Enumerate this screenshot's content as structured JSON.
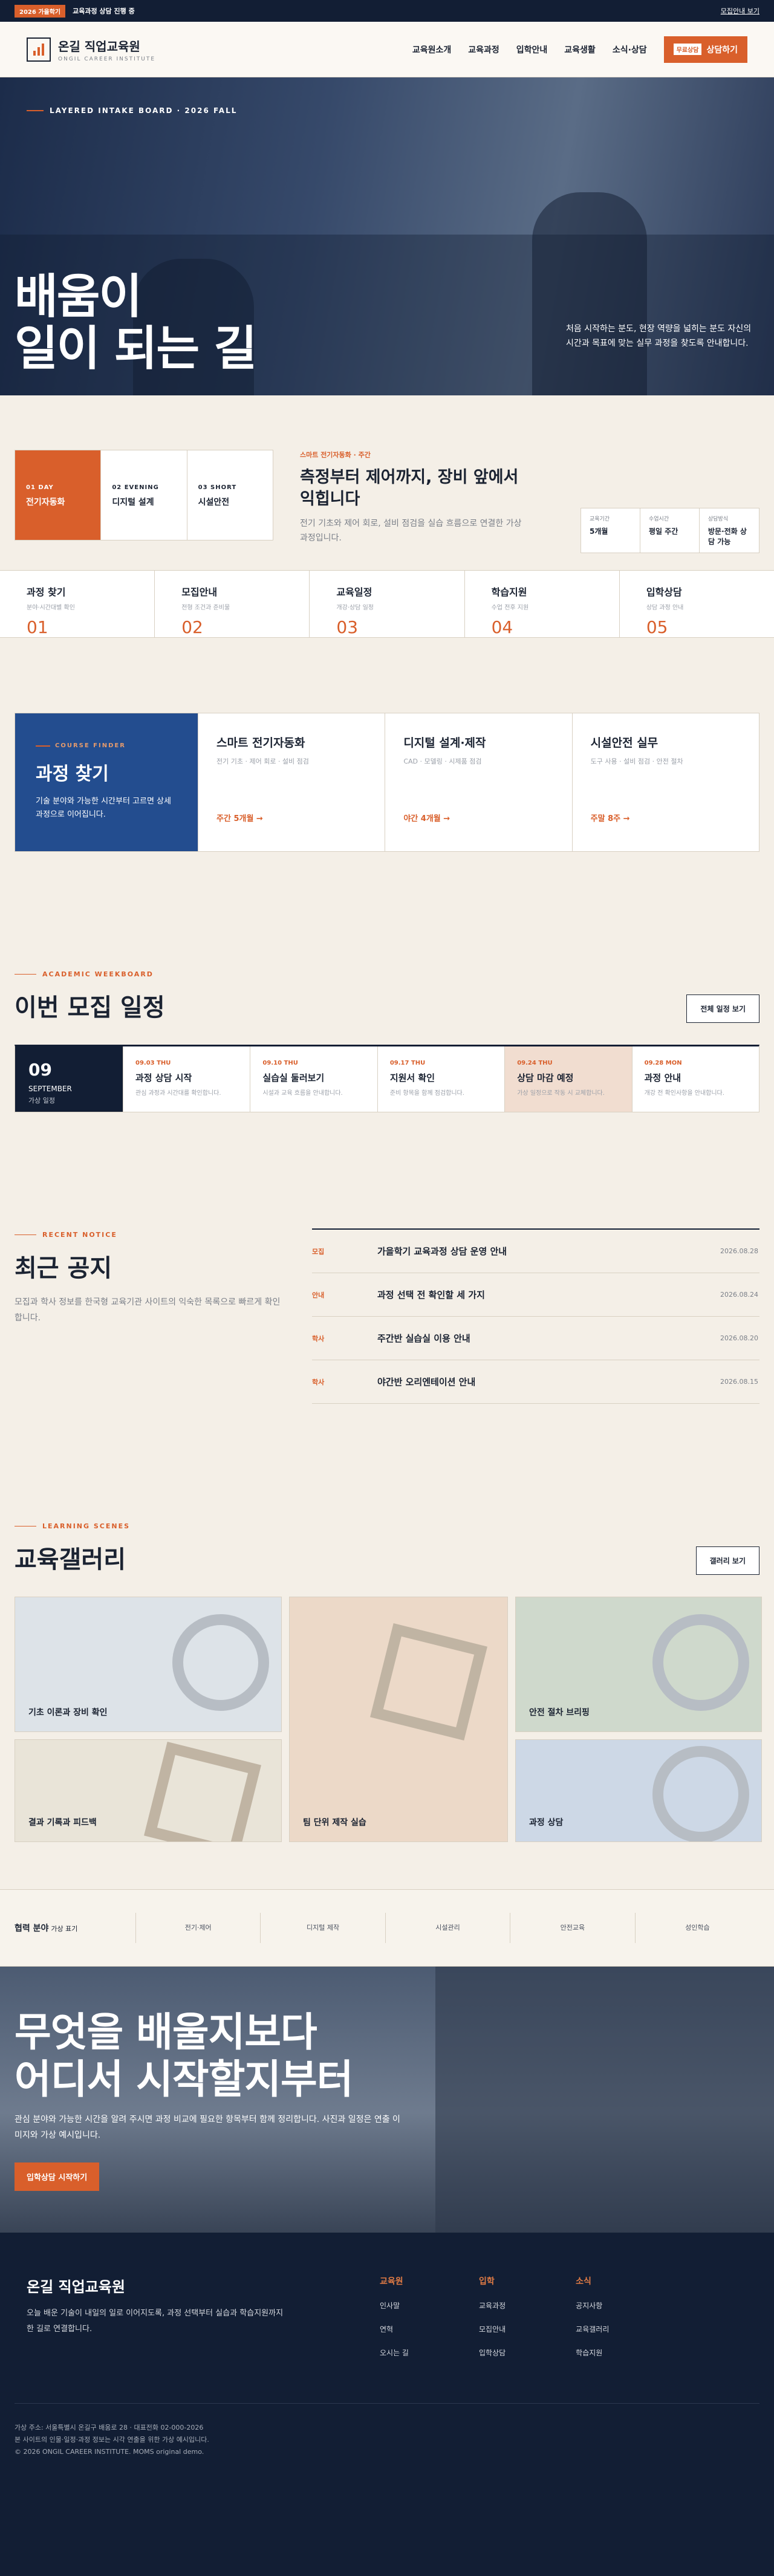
{
  "topbar": {
    "badge": "2026 가을학기",
    "notice": "교육과정 상담 진행 중",
    "right_link": "모집안내 보기"
  },
  "header": {
    "logo_ko": "온길 직업교육원",
    "logo_en": "ONGIL CAREER INSTITUTE",
    "nav": [
      "교육원소개",
      "교육과정",
      "입학안내",
      "교육생활",
      "소식·상담"
    ],
    "cta_tag": "무료상담",
    "cta_label": "상담하기"
  },
  "hero": {
    "kicker": "LAYERED INTAKE BOARD · 2026 FALL",
    "title_line1": "배움이",
    "title_line2": "일이 되는 길",
    "desc": "처음 시작하는 분도, 현장 역량을 넓히는 분도 자신의 시간과 목표에 맞는 실무 과정을 찾도록 안내합니다."
  },
  "track": {
    "tabs": [
      {
        "k": "01 DAY",
        "v": "전기자동화"
      },
      {
        "k": "02 EVENING",
        "v": "디지털 설계"
      },
      {
        "k": "03 SHORT",
        "v": "시설안전"
      }
    ],
    "kicker": "스마트 전기자동화 · 주간",
    "title": "측정부터 제어까지, 장비 앞에서 익힙니다",
    "desc": "전기 기초와 제어 회로, 설비 점검을 실습 흐름으로 연결한 가상 과정입니다.",
    "stats": [
      {
        "l": "교육기간",
        "v": "5개월"
      },
      {
        "l": "수업시간",
        "v": "평일 주간"
      },
      {
        "l": "상담방식",
        "v": "방문·전화 상담 가능"
      }
    ]
  },
  "quick": [
    {
      "t": "과정 찾기",
      "s": "분야·시간대별 확인",
      "n": "01"
    },
    {
      "t": "모집안내",
      "s": "전형 조건과 준비물",
      "n": "02"
    },
    {
      "t": "교육일정",
      "s": "개강·상담 일정",
      "n": "03"
    },
    {
      "t": "학습지원",
      "s": "수업 전후 지원",
      "n": "04"
    },
    {
      "t": "입학상담",
      "s": "상담 과정 안내",
      "n": "05"
    }
  ],
  "finder": {
    "kicker": "COURSE FINDER",
    "title": "과정 찾기",
    "desc": "기술 분야와 가능한 시간부터 고르면 상세 과정으로 이어집니다.",
    "cards": [
      {
        "t": "스마트 전기자동화",
        "s": "전기 기초 · 제어 회로 · 설비 점검",
        "m": "주간 5개월 →"
      },
      {
        "t": "디지털 설계·제작",
        "s": "CAD · 모델링 · 시제품 점검",
        "m": "야간 4개월 →"
      },
      {
        "t": "시설안전 실무",
        "s": "도구 사용 · 설비 점검 · 안전 절차",
        "m": "주말 8주 →"
      }
    ]
  },
  "schedule": {
    "kicker": "ACADEMIC WEEKBOARD",
    "title": "이번 모집 일정",
    "button": "전체 일정 보기",
    "month": {
      "d": "09",
      "m": "SEPTEMBER",
      "g": "가상 일정"
    },
    "events": [
      {
        "dt": "09.03 THU",
        "t": "과정 상담 시작",
        "s": "관심 과정과 시간대를 확인합니다."
      },
      {
        "dt": "09.10 THU",
        "t": "실습실 둘러보기",
        "s": "시설과 교육 흐름을 안내합니다."
      },
      {
        "dt": "09.17 THU",
        "t": "지원서 확인",
        "s": "준비 항목을 함께 점검합니다."
      },
      {
        "dt": "09.24 THU",
        "t": "상담 마감 예정",
        "s": "가상 일정으로 작동 시 교체합니다."
      },
      {
        "dt": "09.28 MON",
        "t": "과정 안내",
        "s": "개강 전 확인사항을 안내합니다."
      }
    ]
  },
  "notice": {
    "kicker": "RECENT NOTICE",
    "title": "최근 공지",
    "desc": "모집과 학사 정보를 한국형 교육기관 사이트의 익숙한 목록으로 빠르게 확인합니다.",
    "items": [
      {
        "c": "모집",
        "t": "가을학기 교육과정 상담 운영 안내",
        "d": "2026.08.28"
      },
      {
        "c": "안내",
        "t": "과정 선택 전 확인할 세 가지",
        "d": "2026.08.24"
      },
      {
        "c": "학사",
        "t": "주간반 실습실 이용 안내",
        "d": "2026.08.20"
      },
      {
        "c": "학사",
        "t": "야간반 오리엔테이션 안내",
        "d": "2026.08.15"
      }
    ]
  },
  "gallery": {
    "kicker": "LEARNING SCENES",
    "title": "교육갤러리",
    "button": "갤러리 보기",
    "items": [
      "기초 이론과 장비 확인",
      "결과 기록과 피드백",
      "팀 단위 제작 실습",
      "안전 절차 브리핑",
      "과정 상담"
    ],
    "colors": [
      "#dde3e8",
      "#e9e4d8",
      "#ecd9c8",
      "#cfd9cc",
      "#cdd8e6"
    ]
  },
  "cats": {
    "lead": "협력 분야",
    "lead_sub": "가상 표기",
    "items": [
      "전기·제어",
      "디지털 제작",
      "시설관리",
      "안전교육",
      "성인학습"
    ]
  },
  "banner": {
    "title_line1": "무엇을 배울지보다",
    "title_line2": "어디서 시작할지부터",
    "desc": "관심 분야와 가능한 시간을 알려 주시면 과정 비교에 필요한 항목부터 함께 정리합니다. 사진과 일정은 연출 이미지와 가상 예시입니다.",
    "button": "입학상담 시작하기"
  },
  "footer": {
    "brand": "온길 직업교육원",
    "desc": "오늘 배운 기술이 내일의 일로 이어지도록, 과정 선택부터 실습과 학습지원까지 한 길로 연결합니다.",
    "cols": [
      {
        "h": "교육원",
        "items": [
          "인사말",
          "연혁",
          "오시는 길"
        ]
      },
      {
        "h": "입학",
        "items": [
          "교육과정",
          "모집안내",
          "입학상담"
        ]
      },
      {
        "h": "소식",
        "items": [
          "공지사항",
          "교육갤러리",
          "학습지원"
        ]
      }
    ],
    "addr": "가상 주소: 서울특별시 온길구 배움로 28 · 대표전화 02-000-2026",
    "note": "본 사이트의 인물·일정·과정 정보는 시각 연출을 위한 가상 예시입니다.",
    "copy": "© 2026 ONGIL CAREER INSTITUTE. MOMS original demo."
  }
}
